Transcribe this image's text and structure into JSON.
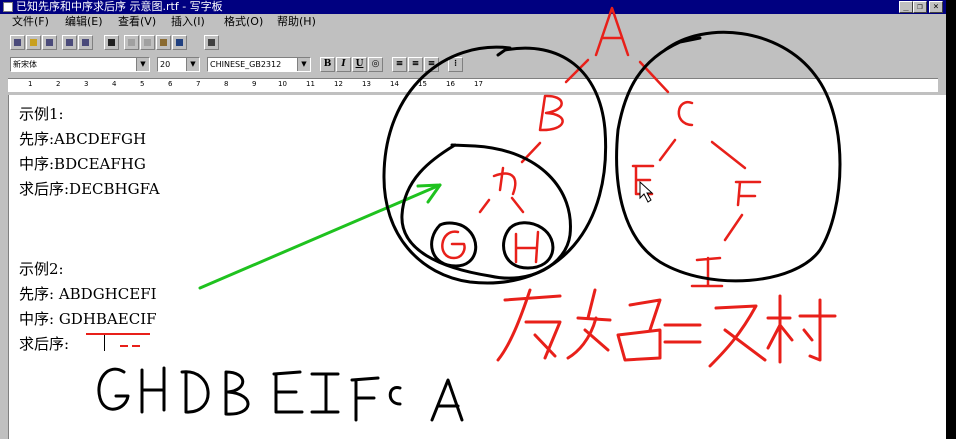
{
  "window": {
    "title": "已知先序和中序求后序 示意图.rtf - 写字板",
    "caption_buttons": {
      "minimize": "_",
      "restore": "❐",
      "close": "×"
    }
  },
  "menu": [
    "文件(F)",
    "编辑(E)",
    "查看(V)",
    "插入(I)",
    "格式(O)",
    "帮助(H)"
  ],
  "format": {
    "font": "新宋体",
    "size": "20",
    "script": "CHINESE_GB2312"
  },
  "ruler_ticks": [
    "1",
    "2",
    "3",
    "4",
    "5",
    "6",
    "7",
    "8",
    "9",
    "10",
    "11",
    "12",
    "13",
    "14",
    "15",
    "16",
    "17"
  ],
  "document": {
    "lines": [
      "示例1:",
      "先序:ABCDEFGH",
      "中序:BDCEAFHG",
      "求后序:DECBHGFA",
      "",
      "示例2:",
      "先序: ABDGHCEFI",
      "中序: GDHBAECIF",
      "求后序:"
    ]
  },
  "annotations": {
    "tree_nodes": [
      "A",
      "B",
      "C",
      "D",
      "E",
      "F",
      "G",
      "H",
      "I"
    ],
    "handwritten_note": "左右=叉树",
    "handwritten_answer": [
      "G",
      "H",
      "D",
      "B",
      "E",
      "I",
      "F",
      "C",
      "A"
    ],
    "colors": {
      "red": "#e8201a",
      "black": "#000000",
      "green": "#1fc21f"
    }
  }
}
